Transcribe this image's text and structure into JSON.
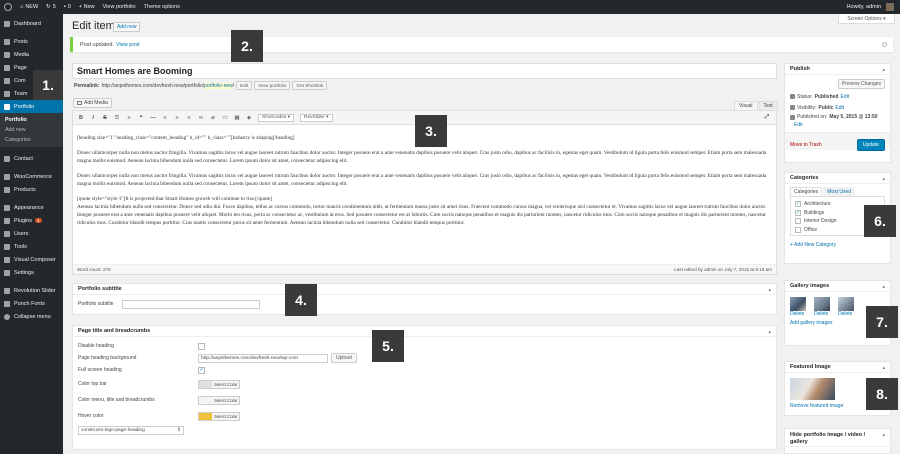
{
  "admin_bar": {
    "site_name": "NEW",
    "updates_count": "5",
    "comments_count": "0",
    "new_label": "+ New",
    "view_portfolio": "View portfolio",
    "theme_options": "Theme options",
    "howdy": "Howdy, admin"
  },
  "sidebar": {
    "items": [
      {
        "label": "Dashboard"
      },
      {
        "label": "Posts"
      },
      {
        "label": "Media"
      },
      {
        "label": "Page"
      },
      {
        "label": "Com"
      },
      {
        "label": "Team"
      },
      {
        "label": "Portfolio"
      },
      {
        "label": "Contact"
      },
      {
        "label": "WooCommerce"
      },
      {
        "label": "Products"
      },
      {
        "label": "Appearance"
      },
      {
        "label": "Plugins",
        "badge": "4"
      },
      {
        "label": "Users"
      },
      {
        "label": "Tools"
      },
      {
        "label": "Visual Composer"
      },
      {
        "label": "Settings"
      },
      {
        "label": "Revolution Slider"
      },
      {
        "label": "Punch Fonts"
      },
      {
        "label": "Collapse menu"
      }
    ],
    "submenu": [
      "Portfolio",
      "Add new",
      "Categories"
    ]
  },
  "page": {
    "title": "Edit item",
    "add_new": "Add new",
    "screen_options": "Screen Options"
  },
  "notice": {
    "text": "Post updated.",
    "link": "View post"
  },
  "post": {
    "title": "Smart Homes are Booming",
    "permalink_label": "Permalink:",
    "permalink_base": "http://anpsthemes.com/devfresh-new/portfolio/",
    "permalink_slug": "portfolio-new",
    "permalink_end": "/",
    "btn_edit": "Edit",
    "btn_view": "View portfolio",
    "btn_shortlink": "Get Shortlink"
  },
  "editor": {
    "add_media": "Add Media",
    "tab_visual": "Visual",
    "tab_text": "Text",
    "shortcodes": "Shortcodes",
    "revslider": "RevSlider",
    "heading_code": "[heading size=\"1\" heading_class=\"content_heading\" h_id=\"\" h_class=\"\"]Industry is shaping[/heading]",
    "p1": "Donec ullamcorper nulla non metus auctor fringilla. Vivamus sagittis lacus vel augue laoreet rutrum faucibus dolor auctor. Integer posuere erat a ante venenatis dapibus posuere velit aliquet. Cras justo odio, dapibus ac facilisis in, egestas eget quam. Vestibulum id ligula porta felis euismod semper. Etiam porta sem malesuada magna mollis euismod. Aenean lacinia bibendum nulla sed consectetur. Lorem ipsum dolor sit amet, consectetur adipiscing elit.",
    "p2": "Donec ullamcorper nulla non metus auctor fringilla. Vivamus sagittis lacus vel augue laoreet rutrum faucibus dolor auctor. Integer posuere erat a ante venenatis dapibus posuere velit aliquet. Cras justo odio, dapibus ac facilisis in, egestas eget quam. Vestibulum id ligula porta felis euismod semper. Etiam porta sem malesuada magna mollis euismod. Aenean lacinia bibendum nulla sed consectetur. Lorem ipsum dolor sit amet, consectetur adipiscing elit.",
    "quote_open": "[quote style=\"style-1\"]It is projected that Smart Homes growth will continue to rise.[/quote]",
    "p3": "Aenean lacinia bibendum nulla sed consectetur. Donec sed odio dui. Fusce dapibus, tellus ac cursus commodo, tortor mauris condimentum nibh, ut fermentum massa justo sit amet risus. Fraecent commodo cursus magna, vel scelerisque nisl consectetur et. Vivamus sagittis lacus vel augue laoreet rutrum faucibus dolor auctor. Integer posuere erat a ante venenatis dapibus posuere velit aliquet. Morbi leo risus, porta ac consectetur ac, vestibulum at eros. Sed posuere consectetur est at lobortis. Cum sociis natoque penatibus et magnis dis parturient montes, nascetur ridiculus mus. Cum sociis natoque penatibus et magnis dis parturient montes, nascetur ridiculus mus. Curabitur blandit tempus porttitor. Cras mattis consectetur purus sit amet fermentum. Aenean lacinia bibendum nulla sed consectetur. Curabitur blandit tempus porttitor.",
    "word_count": "Word count: 278",
    "last_edited": "Last edited by admin on July 7, 2015 at 9:19 am"
  },
  "portfolio_subtitle": {
    "heading": "Portfolio subtitle",
    "label": "Portfolio subtitle",
    "value": ""
  },
  "page_title_box": {
    "heading": "Page title and breadcrumbs",
    "disable_heading": "Disable heading",
    "bg_label": "Page heading background",
    "bg_value": "http://anpsthemes.com/devfresh-new/wp-cont",
    "upload": "Upload",
    "fullscreen": "Full screen heading",
    "color_top_bar": "Color top bar",
    "color_menu": "Color menu, title and breadcrumbs",
    "hover_color": "Hover color",
    "select_color": "Select Color",
    "hover_swatch": "#f0c23b",
    "top_swatch": "#e0e0e0",
    "menu_swatch": "#f4f4f4",
    "logo_select": "constructo-logo-page-heading"
  },
  "publish": {
    "heading": "Publish",
    "preview": "Preview Changes",
    "status_label": "Status:",
    "status_value": "Published",
    "visibility_label": "Visibility:",
    "visibility_value": "Public",
    "published_label": "Published on:",
    "published_value": "May 5, 2015 @ 13:50",
    "edit": "Edit",
    "trash": "Move to Trash",
    "update": "Update"
  },
  "categories": {
    "heading": "Categories",
    "tab_all": "Categories",
    "tab_used": "Most Used",
    "items": [
      {
        "label": "Architecture",
        "checked": true
      },
      {
        "label": "Buildings",
        "checked": true
      },
      {
        "label": "Interior Design",
        "checked": false
      },
      {
        "label": "Office",
        "checked": false
      }
    ],
    "add_new": "+ Add New Category"
  },
  "gallery": {
    "heading": "Gallery images",
    "delete": "Delete",
    "add": "Add gallery images"
  },
  "featured": {
    "heading": "Featured Image",
    "remove": "Remove featured image"
  },
  "hide_box": {
    "heading": "Hide portfolio image / video / gallery"
  },
  "callouts": [
    "1.",
    "2.",
    "3.",
    "4.",
    "5.",
    "6.",
    "7.",
    "8."
  ],
  "colors": {
    "accent": "#0073aa",
    "admin_dark": "#23282d",
    "notice_green": "#7ad03a",
    "update_blue": "#0085ba"
  }
}
